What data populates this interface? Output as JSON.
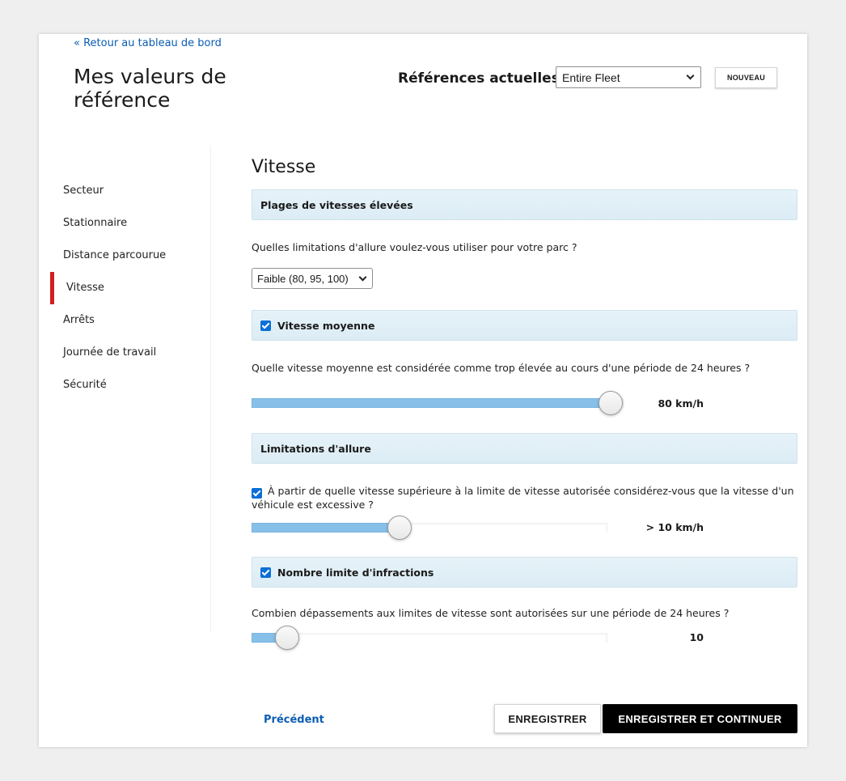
{
  "header": {
    "back_link": "« Retour au tableau de bord",
    "title": "Mes valeurs de référence",
    "refs_label": "Références actuelles :",
    "refs_selected": "Entire Fleet",
    "new_button": "NOUVEAU"
  },
  "sidebar": {
    "items": [
      {
        "label": "Secteur",
        "active": false
      },
      {
        "label": "Stationnaire",
        "active": false
      },
      {
        "label": "Distance parcourue",
        "active": false
      },
      {
        "label": "Vitesse",
        "active": true
      },
      {
        "label": "Arrêts",
        "active": false
      },
      {
        "label": "Journée de travail",
        "active": false
      },
      {
        "label": "Sécurité",
        "active": false
      }
    ]
  },
  "main": {
    "section_title": "Vitesse",
    "high_speed": {
      "header": "Plages de vitesses élevées",
      "question": "Quelles limitations d'allure voulez-vous utiliser pour votre parc ?",
      "selected": "Faible (80, 95, 100)"
    },
    "avg_speed": {
      "header": "Vitesse moyenne",
      "checked": true,
      "question": "Quelle vitesse moyenne est considérée comme trop élevée au cours d'une période de 24 heures ?",
      "slider_fraction": 1.0,
      "value": "80 km/h"
    },
    "speed_limits": {
      "header": "Limitations d'allure",
      "checked": true,
      "question": "À partir de quelle vitesse supérieure à la limite de vitesse autorisée considérez-vous que la vitesse d'un véhicule est excessive ?",
      "slider_fraction": 0.41,
      "value": "> 10 km/h"
    },
    "violations": {
      "header": "Nombre limite d'infractions",
      "checked": true,
      "question": "Combien dépassements aux limites de vitesse sont autorisées sur une période de 24 heures ?",
      "slider_fraction": 0.07,
      "value": "10"
    }
  },
  "footer": {
    "prev_label": "Précédent",
    "save_label": "ENREGISTRER",
    "save_continue_label": "ENREGISTRER ET CONTINUER"
  },
  "colors": {
    "accent_active": "#d21f1f",
    "link": "#0b5db3",
    "slider_fill": "#86c0e8",
    "checkbox": "#0a6fd6"
  }
}
